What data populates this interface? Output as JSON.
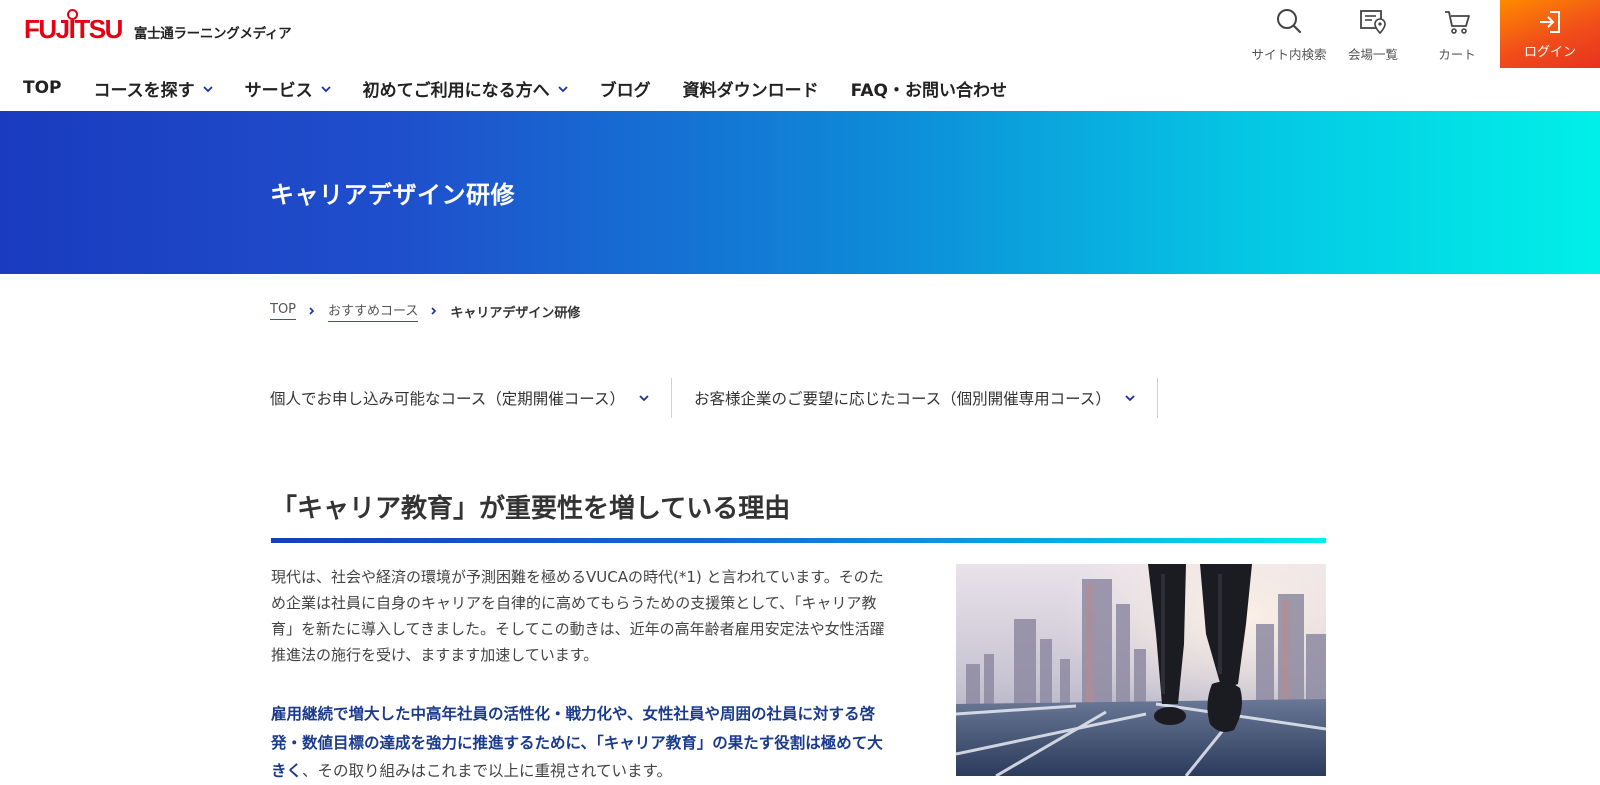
{
  "header": {
    "logo_text": "FUJITSU",
    "logo_subtitle": "富士通ラーニングメディア",
    "utilities": {
      "search_label": "サイト内検索",
      "venue_label": "会場一覧",
      "cart_label": "カート",
      "login_label": "ログイン"
    },
    "nav": [
      {
        "label": "TOP"
      },
      {
        "label": "コースを探す"
      },
      {
        "label": "サービス"
      },
      {
        "label": "初めてご利用になる方へ"
      },
      {
        "label": "ブログ"
      },
      {
        "label": "資料ダウンロード"
      },
      {
        "label": "FAQ・お問い合わせ"
      }
    ]
  },
  "hero": {
    "title": "キャリアデザイン研修"
  },
  "breadcrumb": [
    {
      "label": "TOP"
    },
    {
      "label": "おすすめコース"
    },
    {
      "label": "キャリアデザイン研修"
    }
  ],
  "course_tabs": [
    {
      "label": "個人でお申し込み可能なコース（定期開催コース）"
    },
    {
      "label": "お客様企業のご要望に応じたコース（個別開催専用コース）"
    }
  ],
  "section": {
    "title": "「キャリア教育」が重要性を増している理由",
    "paragraph1": "現代は、社会や経済の環境が予測困難を極めるVUCAの時代(*1) と言われています。そのため企業は社員に自身のキャリアを自律的に高めてもらうための支援策として、「キャリア教育」を新たに導入してきました。そしてこの動きは、近年の高年齢者雇用安定法や女性活躍推進法の施行を受け、ますます加速しています。",
    "paragraph2_strong": "雇用継続で増大した中高年社員の活性化・戦力化や、女性社員や周囲の社員に対する啓発・数値目標の達成を強力に推進するために、「キャリア教育」の果たす役割は極めて大きく",
    "paragraph2_rest": "、その取り組みはこれまで以上に重視されています。"
  },
  "colors": {
    "brand_red": "#e60012",
    "hero_start": "#1a3bbf",
    "hero_end": "#00f0e8",
    "login_orange": "#ff8a00",
    "emphasis_navy": "#1a3a8c"
  }
}
